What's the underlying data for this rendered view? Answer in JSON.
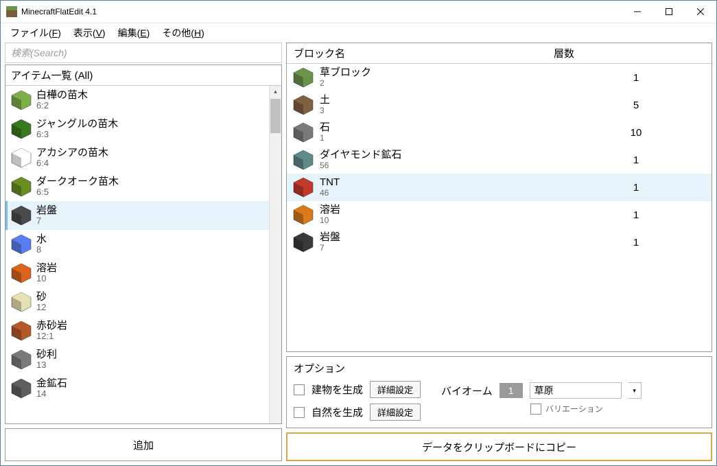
{
  "window": {
    "title": "MinecraftFlatEdit 4.1"
  },
  "menus": {
    "file": "ファイル",
    "file_u": "F",
    "view": "表示",
    "view_u": "V",
    "edit": "編集",
    "edit_u": "E",
    "other": "その他",
    "other_u": "H"
  },
  "search": {
    "placeholder": "検索(Search)"
  },
  "list": {
    "header": "アイテム一覧 (All)"
  },
  "items": [
    {
      "name": "白樺の苗木",
      "id": "6:2",
      "color": "#7cae4a"
    },
    {
      "name": "ジャングルの苗木",
      "id": "6:3",
      "color": "#3b7a1e"
    },
    {
      "name": "アカシアの苗木",
      "id": "6:4",
      "color": "#ffffff"
    },
    {
      "name": "ダークオーク苗木",
      "id": "6:5",
      "color": "#6b8e23"
    },
    {
      "name": "岩盤",
      "id": "7",
      "color": "#4a4a4a",
      "selected": true
    },
    {
      "name": "水",
      "id": "8",
      "color": "#5a7ef2"
    },
    {
      "name": "溶岩",
      "id": "10",
      "color": "#d9641c"
    },
    {
      "name": "砂",
      "id": "12",
      "color": "#e8e0b5"
    },
    {
      "name": "赤砂岩",
      "id": "12:1",
      "color": "#b45a2a"
    },
    {
      "name": "砂利",
      "id": "13",
      "color": "#7a7a7a"
    },
    {
      "name": "金鉱石",
      "id": "14",
      "color": "#5f5f5f"
    }
  ],
  "table": {
    "col1": "ブロック名",
    "col2": "層数",
    "rows": [
      {
        "name": "草ブロック",
        "id": "2",
        "layers": "1",
        "color": "#6b944b"
      },
      {
        "name": "土",
        "id": "3",
        "layers": "5",
        "color": "#806043"
      },
      {
        "name": "石",
        "id": "1",
        "layers": "10",
        "color": "#7a7a7a"
      },
      {
        "name": "ダイヤモンド鉱石",
        "id": "56",
        "layers": "1",
        "color": "#5f8a8a"
      },
      {
        "name": "TNT",
        "id": "46",
        "layers": "1",
        "color": "#c0392b",
        "selected": true
      },
      {
        "name": "溶岩",
        "id": "10",
        "layers": "1",
        "color": "#d97a1c"
      },
      {
        "name": "岩盤",
        "id": "7",
        "layers": "1",
        "color": "#3a3a3a"
      }
    ]
  },
  "options": {
    "title": "オプション",
    "gen_buildings": "建物を生成",
    "gen_nature": "自然を生成",
    "detail": "詳細設定",
    "biome_label": "バイオーム",
    "biome_num": "1",
    "biome_name": "草原",
    "variation": "バリエーション"
  },
  "buttons": {
    "add": "追加",
    "copy": "データをクリップボードにコピー"
  }
}
